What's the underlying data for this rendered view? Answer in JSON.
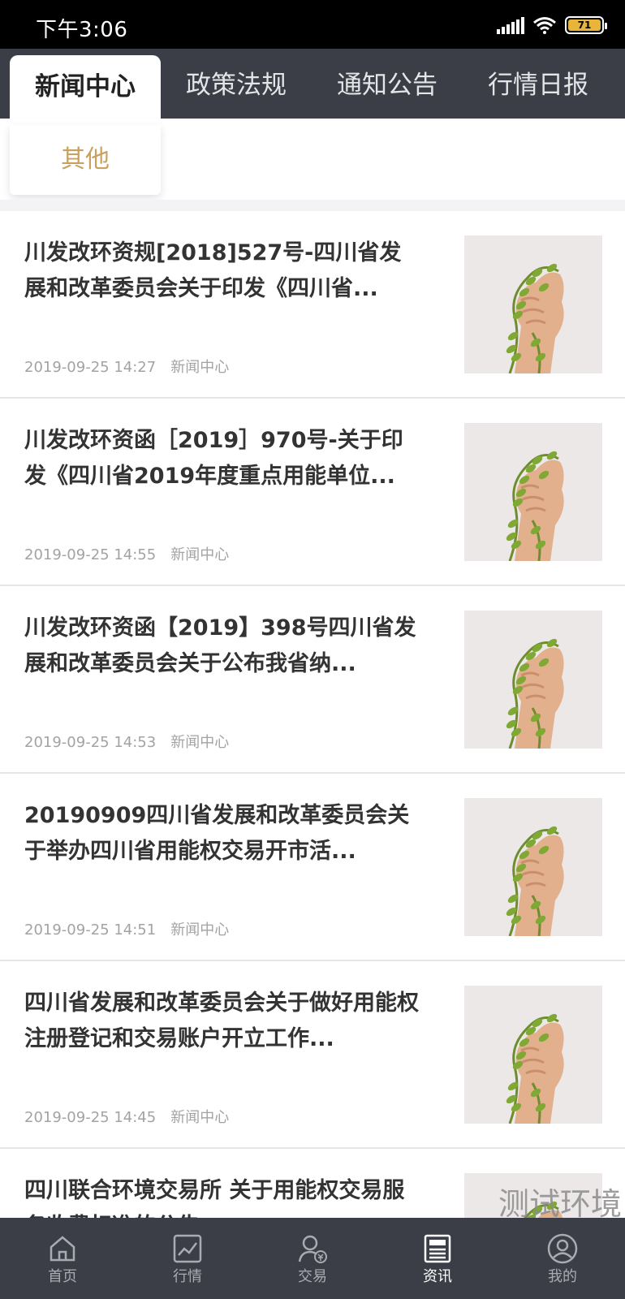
{
  "status_bar": {
    "time": "下午3:06",
    "battery": "71"
  },
  "tabs": [
    {
      "label": "新闻中心",
      "active": true
    },
    {
      "label": "政策法规",
      "active": false
    },
    {
      "label": "通知公告",
      "active": false
    },
    {
      "label": "行情日报",
      "active": false
    }
  ],
  "sub_tabs": [
    {
      "label": "其他"
    }
  ],
  "news": [
    {
      "title": "川发改环资规[2018]527号-四川省发展和改革委员会关于印发《四川省...",
      "time": "2019-09-25 14:27",
      "source": "新闻中心"
    },
    {
      "title": "川发改环资函［2019］970号-关于印发《四川省2019年度重点用能单位...",
      "time": "2019-09-25 14:55",
      "source": "新闻中心"
    },
    {
      "title": "川发改环资函【2019】398号四川省发展和改革委员会关于公布我省纳...",
      "time": "2019-09-25 14:53",
      "source": "新闻中心"
    },
    {
      "title": "20190909四川省发展和改革委员会关于举办四川省用能权交易开市活...",
      "time": "2019-09-25 14:51",
      "source": "新闻中心"
    },
    {
      "title": "四川省发展和改革委员会关于做好用能权注册登记和交易账户开立工作...",
      "time": "2019-09-25 14:45",
      "source": "新闻中心"
    },
    {
      "title": "四川联合环境交易所 关于用能权交易服务收费标准的公告",
      "time": "",
      "source": ""
    }
  ],
  "watermark": "测试环境",
  "bottom_nav": [
    {
      "label": "首页",
      "icon": "home-icon",
      "active": false
    },
    {
      "label": "行情",
      "icon": "chart-icon",
      "active": false
    },
    {
      "label": "交易",
      "icon": "trade-icon",
      "active": false
    },
    {
      "label": "资讯",
      "icon": "news-icon",
      "active": true
    },
    {
      "label": "我的",
      "icon": "user-icon",
      "active": false
    }
  ]
}
